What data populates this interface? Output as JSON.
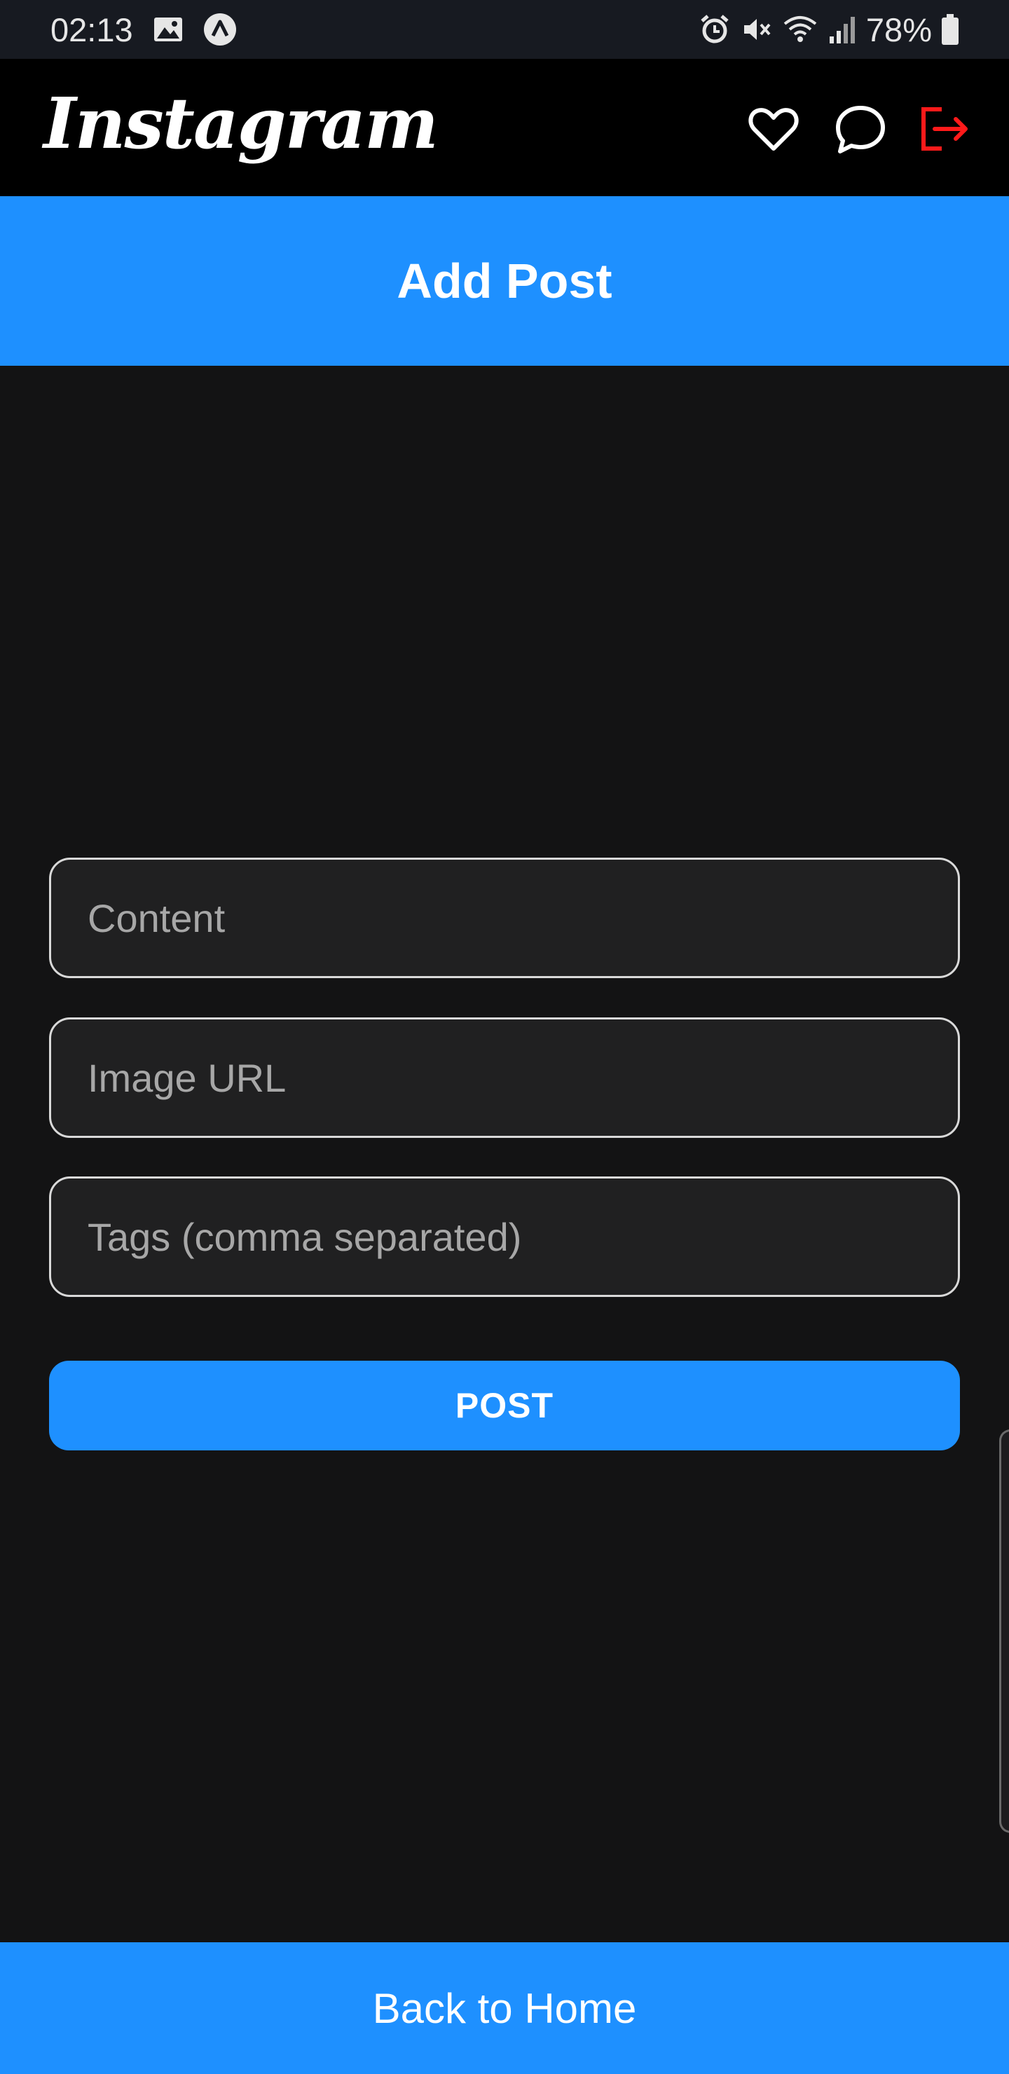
{
  "status_bar": {
    "time": "02:13",
    "battery": "78%",
    "left_icons": [
      "gallery-icon",
      "assistant-icon"
    ],
    "right_icons": [
      "alarm-icon",
      "mute-icon",
      "wifi-icon",
      "signal-icon",
      "battery-icon"
    ]
  },
  "top_nav": {
    "logo": "Instagram",
    "icons": [
      "heart-icon",
      "message-icon",
      "logout-icon"
    ],
    "logout_color": "#ff1a1a"
  },
  "header": {
    "title": "Add Post",
    "color": "#1e90ff"
  },
  "form": {
    "content_placeholder": "Content",
    "image_url_placeholder": "Image URL",
    "tags_placeholder": "Tags (comma separated)",
    "content_value": "",
    "image_url_value": "",
    "tags_value": "",
    "submit_label": "POST"
  },
  "footer": {
    "back_label": "Back to Home"
  }
}
